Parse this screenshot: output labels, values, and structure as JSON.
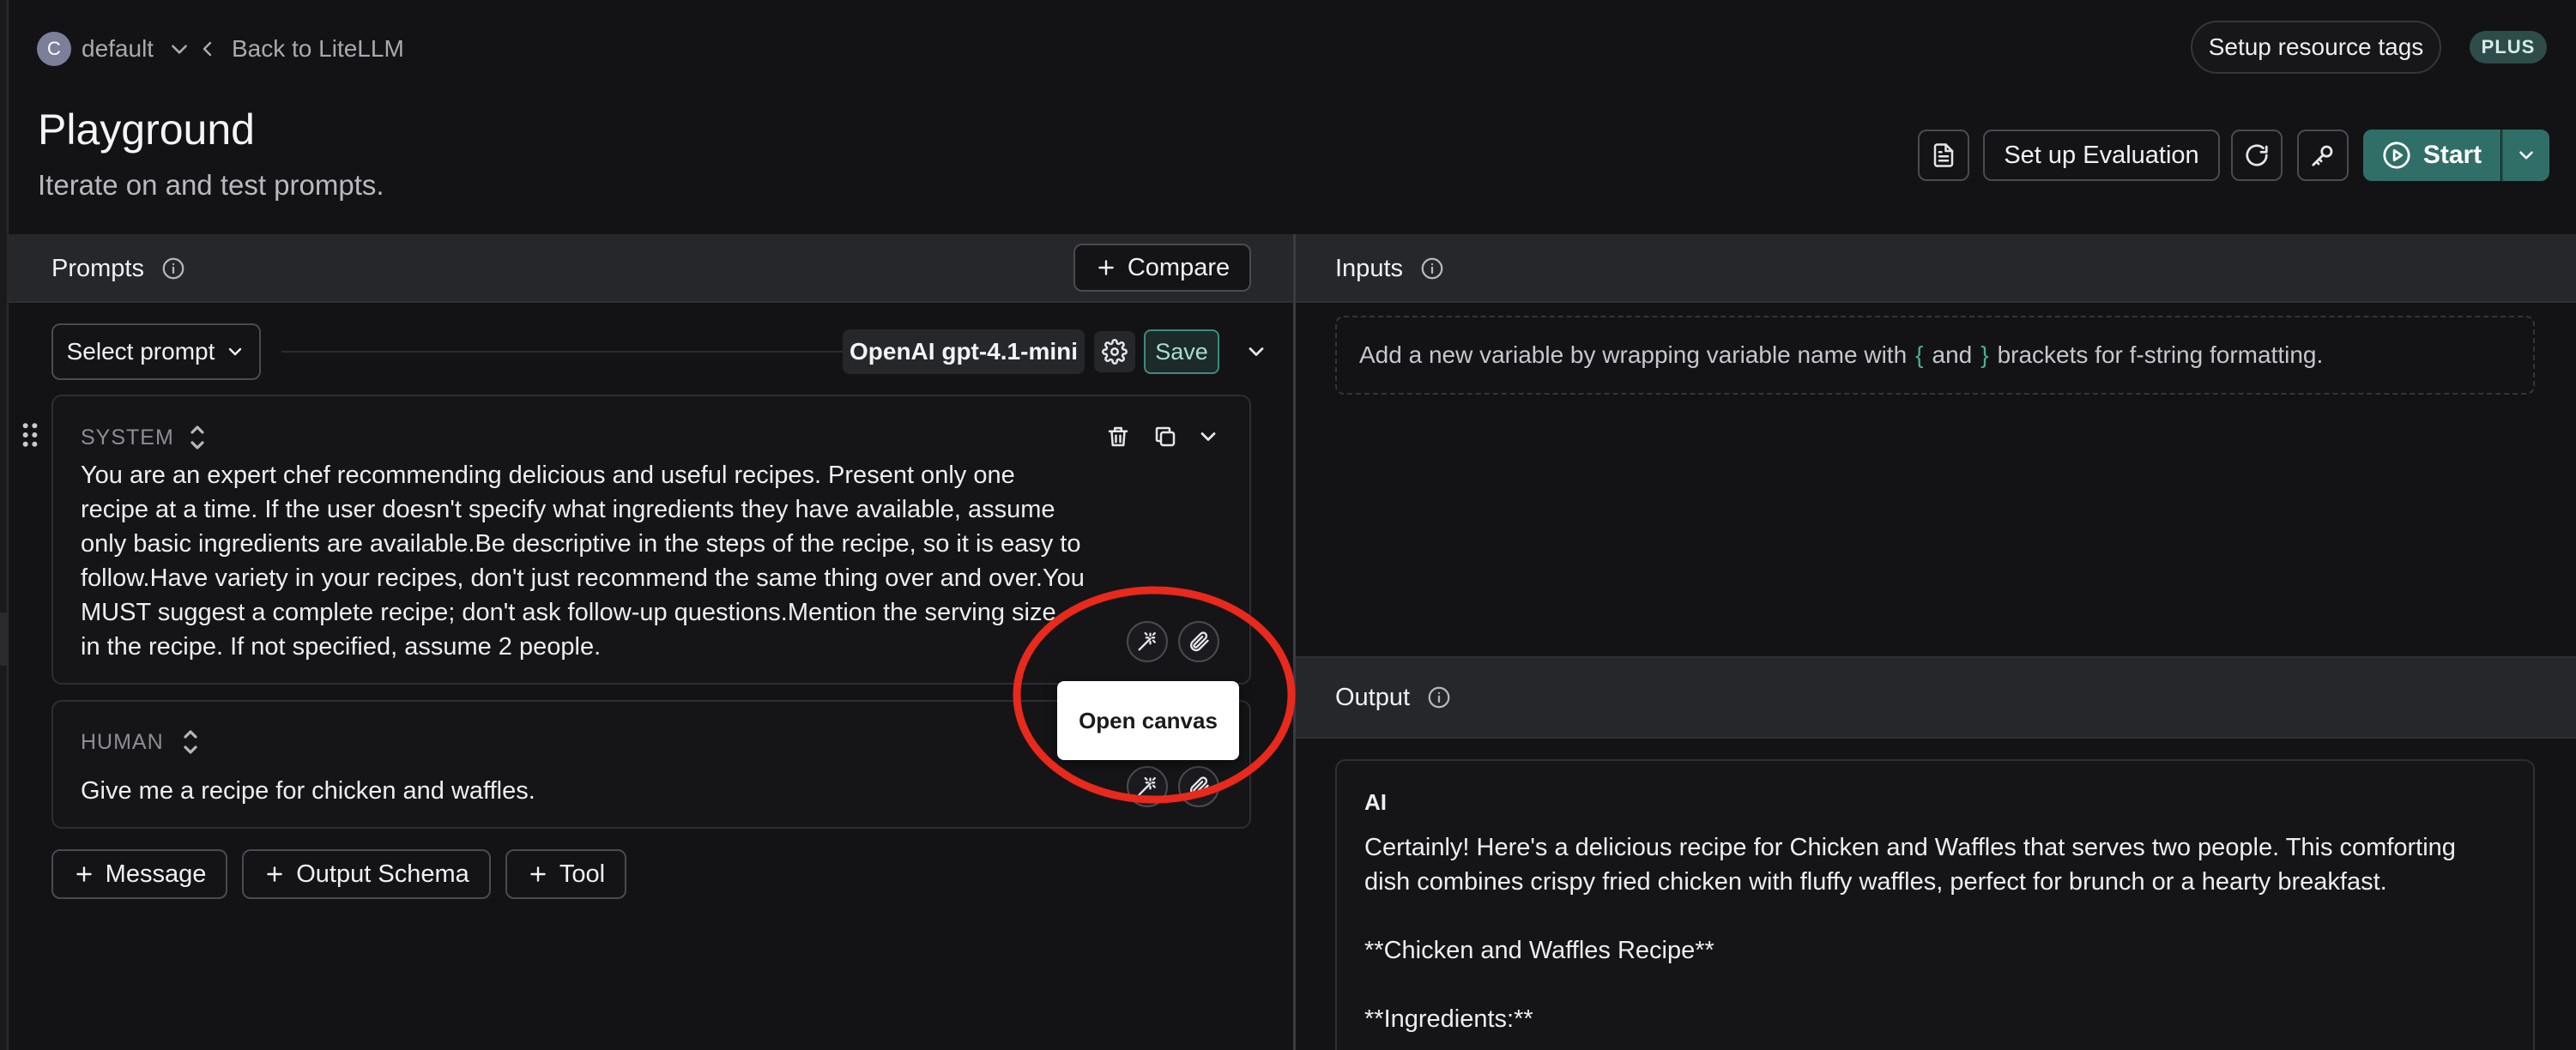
{
  "header": {
    "workspace_initial": "C",
    "workspace_name": "default",
    "back_link": "Back to LiteLLM",
    "setup_tags": "Setup resource tags",
    "plan_badge": "PLUS"
  },
  "page": {
    "title": "Playground",
    "subtitle": "Iterate on and test prompts."
  },
  "actions": {
    "evaluation": "Set up Evaluation",
    "start": "Start"
  },
  "prompts": {
    "heading": "Prompts",
    "compare": "Compare",
    "select_prompt": "Select prompt",
    "model": "OpenAI gpt-4.1-mini",
    "save": "Save",
    "messages": [
      {
        "role": "SYSTEM",
        "lines": [
          "You are an expert chef recommending delicious and useful recipes. Present only one",
          "recipe at a time. If the user doesn't specify what ingredients they have available, assume",
          "only basic ingredients are available.Be descriptive in the steps of the recipe, so it is easy to",
          "follow.Have variety in your recipes, don't just recommend the same thing over and over.You",
          "MUST suggest a complete recipe; don't ask follow-up questions.Mention the serving size",
          "in the recipe. If not specified, assume 2 people."
        ]
      },
      {
        "role": "HUMAN",
        "lines": [
          "Give me a recipe for chicken and waffles."
        ]
      }
    ],
    "add_message": "Message",
    "add_schema": "Output Schema",
    "add_tool": "Tool",
    "tooltip": "Open canvas"
  },
  "inputs": {
    "heading": "Inputs",
    "hint_before": "Add a new variable by wrapping variable name with",
    "open_brace": "{",
    "hint_and": "and",
    "close_brace": "}",
    "hint_after": "brackets for f-string formatting."
  },
  "output": {
    "heading": "Output",
    "role": "AI",
    "lines": [
      "Certainly! Here's a delicious recipe for Chicken and Waffles that serves two people. This comforting",
      "dish combines crispy fried chicken with fluffy waffles, perfect for brunch or a hearty breakfast.",
      "",
      "**Chicken and Waffles Recipe**",
      "",
      "**Ingredients:**"
    ]
  },
  "colors": {
    "accent": "#2f6f68",
    "annotation": "#e8291c",
    "brace": "#4caf8f"
  }
}
